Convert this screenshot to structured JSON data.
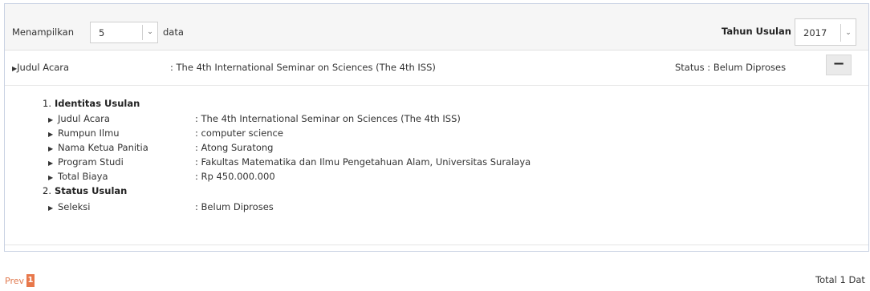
{
  "controls": {
    "show_label": "Menampilkan",
    "entries_value": "5",
    "data_label": "data",
    "year_label": "Tahun Usulan",
    "year_value": "2017"
  },
  "row": {
    "title_label": "Judul Acara",
    "title_value": ": The 4th International Seminar on Sciences (The 4th ISS)",
    "status": "Status : Belum Diproses",
    "collapse_symbol": "−"
  },
  "details": {
    "section1": {
      "num": "1.",
      "title": "Identitas Usulan"
    },
    "items1": [
      {
        "label": "Judul Acara",
        "value": ": The 4th International Seminar on Sciences (The 4th ISS)"
      },
      {
        "label": "Rumpun Ilmu",
        "value": ": computer science"
      },
      {
        "label": "Nama Ketua Panitia",
        "value": ": Atong Suratong"
      },
      {
        "label": "Program Studi",
        "value": ": Fakultas Matematika dan Ilmu Pengetahuan Alam, Universitas Suralaya"
      },
      {
        "label": "Total Biaya",
        "value": ": Rp 450.000.000"
      }
    ],
    "section2": {
      "num": "2.",
      "title": "Status Usulan"
    },
    "items2": [
      {
        "label": "Seleksi",
        "value": ": Belum Diproses"
      }
    ]
  },
  "pagination": {
    "prev": "Prev",
    "current_page": "1",
    "total_text": "Total 1 Dat"
  }
}
